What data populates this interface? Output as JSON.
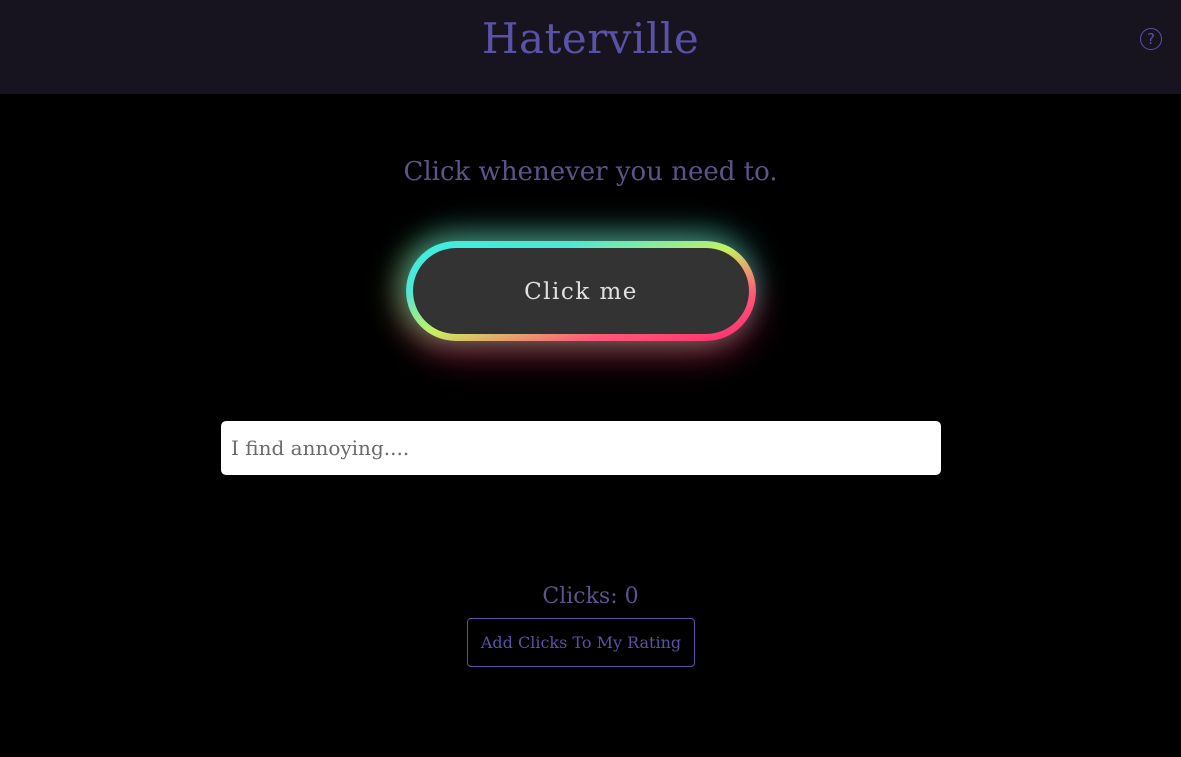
{
  "header": {
    "title": "Haterville",
    "help_icon": "question-circle-icon",
    "help_symbol": "?"
  },
  "main": {
    "tagline": "Click whenever you need to.",
    "click_button_label": "Click me",
    "annoy_input": {
      "value": "",
      "placeholder": "I find annoying...."
    },
    "clicks_label": "Clicks: 0",
    "clicks_count": 0,
    "rating_button_label": "Add Clicks To My Rating"
  },
  "colors": {
    "header_bg": "#17141f",
    "page_bg": "#000000",
    "accent": "#5a52a6",
    "muted_text": "#5c538a",
    "button_fill": "#333333",
    "glow_top": "#3cf0e0",
    "glow_bottom": "#ff2a70"
  }
}
